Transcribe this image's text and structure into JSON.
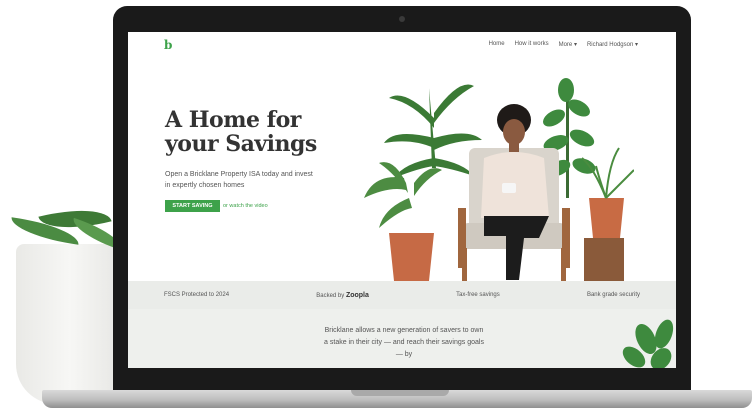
{
  "nav": {
    "logo": "b",
    "links": [
      "Home",
      "How it works",
      "More",
      "Richard Hodgson"
    ]
  },
  "hero": {
    "headline_line1": "A Home for",
    "headline_line2": "your Savings",
    "subtitle": "Open a Bricklane Property ISA today and invest in expertly chosen homes",
    "cta_label": "START SAVING",
    "video_link": "or watch the video"
  },
  "features": {
    "fscs": "FSCS Protected to 2024",
    "backed_by": "Backed by",
    "zoopla": "Zoopla",
    "tax_free": "Tax-free savings",
    "bank_grade": "Bank grade security"
  },
  "body": {
    "text": "Bricklane allows a new generation of savers to own a stake in their city — and reach their savings goals — by"
  },
  "colors": {
    "accent": "#3da24a",
    "strip": "#eaece9",
    "laptop_bezel": "#1a1a1a"
  }
}
